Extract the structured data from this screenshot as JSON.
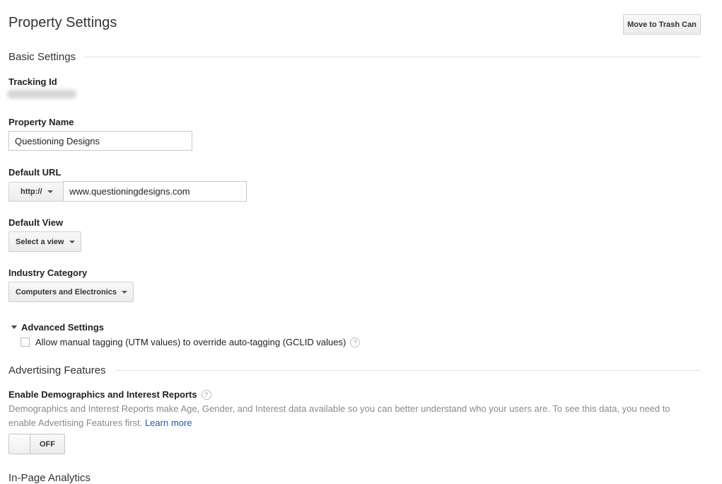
{
  "page": {
    "title": "Property Settings"
  },
  "toolbar": {
    "trash_label": "Move to Trash Can"
  },
  "basic_settings": {
    "heading": "Basic Settings",
    "tracking_id_label": "Tracking Id",
    "property_name_label": "Property Name",
    "property_name_value": "Questioning Designs",
    "default_url_label": "Default URL",
    "protocol_value": "http://",
    "url_value": "www.questioningdesigns.com",
    "default_view_label": "Default View",
    "default_view_value": "Select a view",
    "industry_label": "Industry Category",
    "industry_value": "Computers and Electronics"
  },
  "advanced_settings": {
    "heading": "Advanced Settings",
    "manual_tagging_label": "Allow manual tagging (UTM values) to override auto-tagging (GCLID values)",
    "manual_tagging_checked": false
  },
  "advertising": {
    "heading": "Advertising Features",
    "demographics_label": "Enable Demographics and Interest Reports",
    "description": "Demographics and Interest Reports make Age, Gender, and Interest data available so you can better understand who your users are. To see this data, you need to enable Advertising Features first.",
    "learn_more": "Learn more",
    "toggle_state": "OFF"
  },
  "next_section": {
    "heading": "In-Page Analytics"
  },
  "icons": {
    "help": "help-icon",
    "caret": "caret-down-icon",
    "expand": "triangle-down-icon"
  },
  "colors": {
    "link": "#1f58b6",
    "muted_text": "#8a8a8a",
    "rule": "#e2e2e2"
  }
}
